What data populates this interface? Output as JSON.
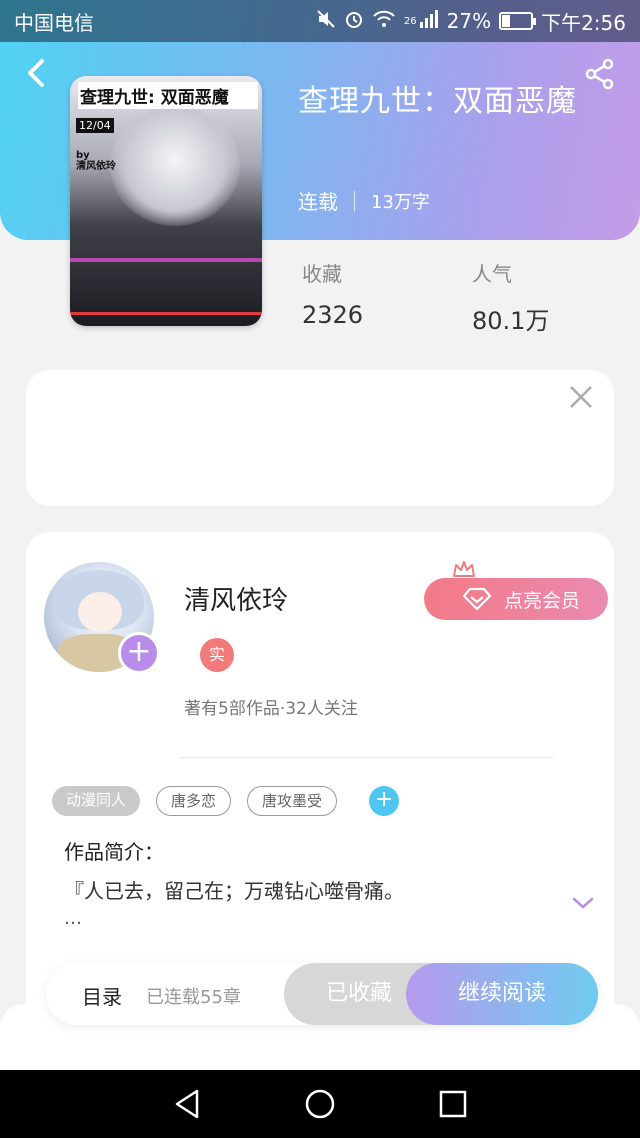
{
  "status_bar": {
    "carrier": "中国电信",
    "network": "26",
    "battery": "27%",
    "battery_level": 0.27,
    "time": "下午2:56"
  },
  "book": {
    "cover": {
      "title": "查理九世: 双面恶魔",
      "date": "12/04",
      "by": "by",
      "author": "清风依玲"
    },
    "title": "查理九世：双面恶魔",
    "status": "连载",
    "words": "13万字",
    "stats": [
      {
        "label": "收藏",
        "value": "2326"
      },
      {
        "label": "人气",
        "value": "80.1万"
      }
    ]
  },
  "author": {
    "name": "清风依玲",
    "verified_badge": "实",
    "summary": "著有5部作品·32人关注",
    "vip_button": "点亮会员"
  },
  "tags": {
    "filled": "动漫同人",
    "outline": [
      "唐多恋",
      "唐攻墨受"
    ]
  },
  "intro": {
    "title": "作品简介：",
    "text": "『人已去，留己在；万魂钻心噬骨痛。",
    "ellipsis": "…"
  },
  "action_bar": {
    "toc": "目录",
    "chapters": "已连载55章",
    "collected": "已收藏",
    "continue": "继续阅读"
  },
  "colors": {
    "gradient_start": "#4fd3f2",
    "gradient_end": "#c59ce8",
    "vip": "#f37a86",
    "accent_purple": "#b98bea",
    "accent_blue": "#4dc7ef"
  }
}
